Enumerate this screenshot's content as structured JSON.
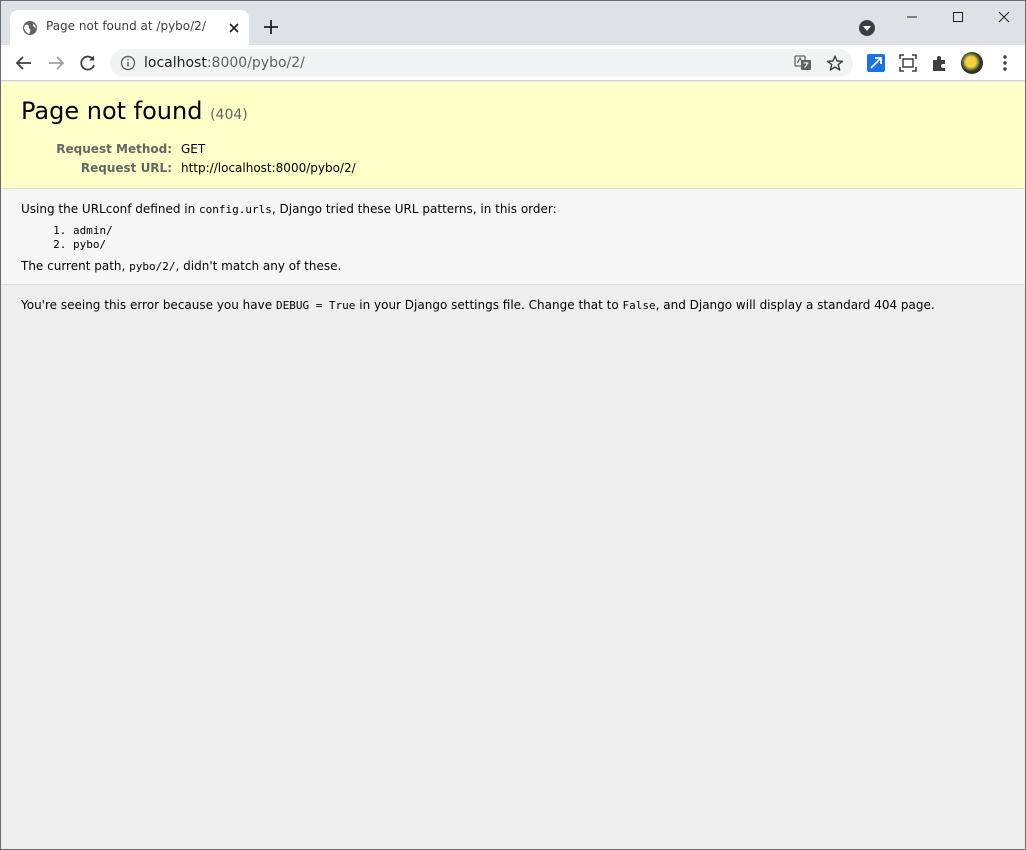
{
  "browser": {
    "tab": {
      "title": "Page not found at /pybo/2/",
      "favicon": "globe-icon"
    },
    "omnibox": {
      "url_host": "localhost",
      "url_rest": ":8000/pybo/2/"
    },
    "colors": {
      "tabstrip": "#dee1e6",
      "omnibox": "#f1f3f4",
      "summary_bg": "#ffffc8"
    }
  },
  "page": {
    "title": "Page not found",
    "status_code": "(404)",
    "meta": [
      {
        "label": "Request Method:",
        "value": "GET"
      },
      {
        "label": "Request URL:",
        "value": "http://localhost:8000/pybo/2/"
      }
    ],
    "info": {
      "intro_before": "Using the URLconf defined in ",
      "urlconf": "config.urls",
      "intro_after": ", Django tried these URL patterns, in this order:",
      "patterns": [
        "admin/",
        "pybo/"
      ],
      "current_before": "The current path, ",
      "current_path": "pybo/2/",
      "current_after": ", didn't match any of these."
    },
    "explanation": {
      "part1": "You're seeing this error because you have ",
      "debug_setting": "DEBUG = True",
      "part2": " in your Django settings file. Change that to ",
      "false_value": "False",
      "part3": ", and Django will display a standard 404 page."
    }
  }
}
